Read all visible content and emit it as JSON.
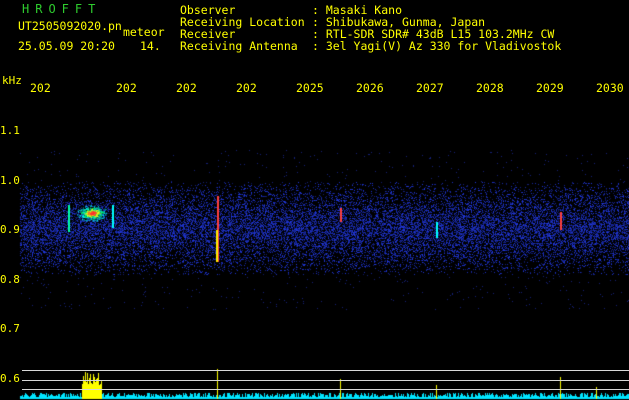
{
  "header": {
    "app_title": "HROFFT",
    "file_name": "UT2505092020.pn",
    "file_suffix": "meteor",
    "date_time": "25.05.09 20:20",
    "frame_num": "14."
  },
  "info": [
    {
      "label": "Observer",
      "value": ": Masaki Kano"
    },
    {
      "label": "Receiving Location",
      "value": ": Shibukawa, Gunma, Japan"
    },
    {
      "label": "Receiver",
      "value": ": RTL-SDR SDR# 43dB L15 103.2MHz CW"
    },
    {
      "label": "Receiving Antenna",
      "value": ": 3el Yagi(V) Az 330 for Vladivostok"
    }
  ],
  "axis": {
    "unit": "kHz",
    "time_labels": [
      "202",
      "202",
      "202",
      "202",
      "2025",
      "2026",
      "2027",
      "2028",
      "2029",
      "2030"
    ],
    "freq_labels": [
      "1.1",
      "1.0",
      "0.9",
      "0.8",
      "0.7",
      "0.6"
    ]
  },
  "colors": {
    "text": "#ffff00",
    "title": "#2ecc2e",
    "noise": "#1a2a9a",
    "trace": "#00e5ff"
  }
}
